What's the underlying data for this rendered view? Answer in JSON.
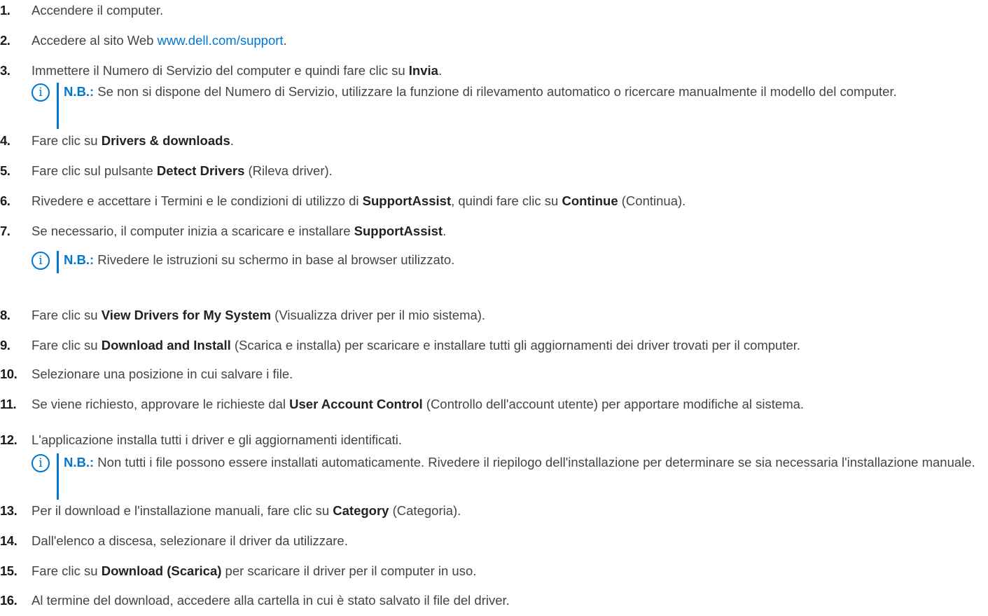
{
  "steps": [
    {
      "num": "1.",
      "parts": [
        {
          "t": "Accendere il computer."
        }
      ]
    },
    {
      "num": "2.",
      "parts": [
        {
          "t": "Accedere al sito Web "
        },
        {
          "t": "www.dell.com/support",
          "link": true
        },
        {
          "t": "."
        }
      ]
    },
    {
      "num": "3.",
      "parts": [
        {
          "t": "Immettere il Numero di Servizio del computer e quindi fare clic su "
        },
        {
          "t": "Invia",
          "b": true
        },
        {
          "t": "."
        }
      ]
    },
    {
      "num": "4.",
      "parts": [
        {
          "t": "Fare clic su "
        },
        {
          "t": "Drivers & downloads",
          "b": true
        },
        {
          "t": "."
        }
      ]
    },
    {
      "num": "5.",
      "parts": [
        {
          "t": "Fare clic sul pulsante "
        },
        {
          "t": "Detect Drivers",
          "b": true
        },
        {
          "t": " (Rileva driver)."
        }
      ]
    },
    {
      "num": "6.",
      "parts": [
        {
          "t": "Rivedere e accettare i Termini e le condizioni di utilizzo di "
        },
        {
          "t": "SupportAssist",
          "b": true
        },
        {
          "t": ", quindi fare clic su "
        },
        {
          "t": "Continue",
          "b": true
        },
        {
          "t": " (Continua)."
        }
      ]
    },
    {
      "num": "7.",
      "parts": [
        {
          "t": "Se necessario, il computer inizia a scaricare e installare "
        },
        {
          "t": "SupportAssist",
          "b": true
        },
        {
          "t": "."
        }
      ]
    },
    {
      "num": "8.",
      "parts": [
        {
          "t": "Fare clic su "
        },
        {
          "t": "View Drivers for My System",
          "b": true
        },
        {
          "t": " (Visualizza driver per il mio sistema)."
        }
      ]
    },
    {
      "num": "9.",
      "parts": [
        {
          "t": "Fare clic su "
        },
        {
          "t": "Download and Install",
          "b": true
        },
        {
          "t": " (Scarica e installa) per scaricare e installare tutti gli aggiornamenti dei driver trovati per il computer."
        }
      ]
    },
    {
      "num": "10.",
      "parts": [
        {
          "t": "Selezionare una posizione in cui salvare i file."
        }
      ]
    },
    {
      "num": "11.",
      "parts": [
        {
          "t": "Se viene richiesto, approvare le richieste dal "
        },
        {
          "t": "User Account Control",
          "b": true
        },
        {
          "t": " (Controllo dell'account utente) per apportare modifiche al sistema."
        }
      ]
    },
    {
      "num": "12.",
      "parts": [
        {
          "t": "L'applicazione installa tutti i driver e gli aggiornamenti identificati."
        }
      ]
    },
    {
      "num": "13.",
      "parts": [
        {
          "t": "Per il download e l'installazione manuali, fare clic su "
        },
        {
          "t": "Category",
          "b": true
        },
        {
          "t": " (Categoria)."
        }
      ]
    },
    {
      "num": "14.",
      "parts": [
        {
          "t": "Dall'elenco a discesa, selezionare il driver da utilizzare."
        }
      ]
    },
    {
      "num": "15.",
      "parts": [
        {
          "t": "Fare clic su "
        },
        {
          "t": "Download (Scarica)",
          "b": true
        },
        {
          "t": " per scaricare il driver per il computer in uso."
        }
      ]
    },
    {
      "num": "16.",
      "parts": [
        {
          "t": "Al termine del download, accedere alla cartella in cui è stato salvato il file del driver."
        }
      ]
    }
  ],
  "notes": [
    {
      "label": "N.B.:",
      "text": " Se non si dispone del Numero di Servizio, utilizzare la funzione di rilevamento automatico o ricercare manualmente il modello del computer."
    },
    {
      "label": "N.B.:",
      "text": " Rivedere le istruzioni su schermo in base al browser utilizzato."
    },
    {
      "label": "N.B.:",
      "text": " Non tutti i file possono essere installati automaticamente. Rivedere il riepilogo dell'installazione per determinare se sia necessaria l'installazione manuale."
    }
  ],
  "note_icon": "info-icon",
  "accent": "#0076ce"
}
